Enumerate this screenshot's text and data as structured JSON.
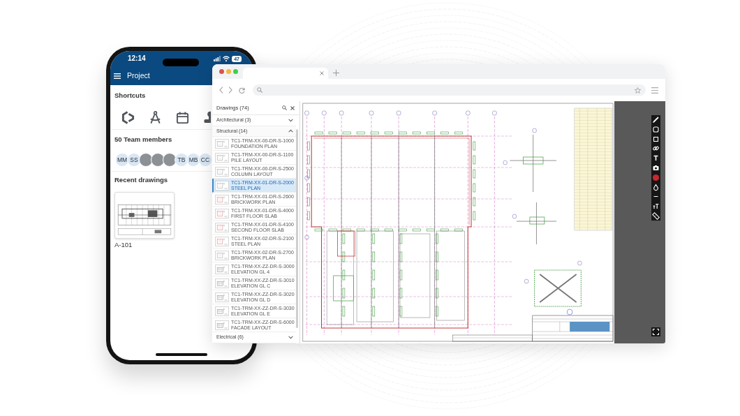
{
  "phone": {
    "status_bar": {
      "time": "12:14",
      "battery": "47"
    },
    "header": {
      "title": "Project"
    },
    "shortcuts": {
      "title": "Shortcuts"
    },
    "team": {
      "title": "50 Team members",
      "members": [
        {
          "kind": "initials",
          "label": "MM"
        },
        {
          "kind": "initials",
          "label": "SS"
        },
        {
          "kind": "photo"
        },
        {
          "kind": "photo"
        },
        {
          "kind": "photo"
        },
        {
          "kind": "initials",
          "label": "TB"
        },
        {
          "kind": "initials",
          "label": "MB"
        },
        {
          "kind": "initials",
          "label": "CC"
        }
      ]
    },
    "recent": {
      "title": "Recent drawings",
      "drawings": [
        {
          "label": "A-101"
        }
      ]
    }
  },
  "browser": {
    "drawings_panel": {
      "title": "Drawings (74)",
      "groups": [
        {
          "label": "Architectural (3)",
          "expanded": false
        },
        {
          "label": "Structural (14)",
          "expanded": true,
          "items": [
            {
              "code": "TC1-TRM-XX-00-DR-S-1000",
              "name": "FOUNDATION PLAN",
              "selected": false
            },
            {
              "code": "TC1-TRM-XX-00-DR-S-1100",
              "name": "PILE LAYOUT",
              "selected": false
            },
            {
              "code": "TC1-TRM-XX-00-DR-S-2500",
              "name": "COLUMN LAYOUT",
              "selected": false
            },
            {
              "code": "TC1-TRM-XX-01-DR-S-2000",
              "name": "STEEL PLAN",
              "selected": true
            },
            {
              "code": "TC1-TRM-XX-01-DR-S-2600",
              "name": "BRICKWORK PLAN",
              "selected": false
            },
            {
              "code": "TC1-TRM-XX-01-DR-S-4000",
              "name": "FIRST FLOOR SLAB",
              "selected": false
            },
            {
              "code": "TC1-TRM-XX-01-DR-S-4100",
              "name": "SECOND FLOOR SLAB",
              "selected": false
            },
            {
              "code": "TC1-TRM-XX-02-DR-S-2100",
              "name": "STEEL PLAN",
              "selected": false
            },
            {
              "code": "TC1-TRM-XX-02-DR-S-2700",
              "name": "BRICKWORK PLAN",
              "selected": false
            },
            {
              "code": "TC1-TRM-XX-ZZ-DR-S-3000",
              "name": "ELEVATION GL 4",
              "selected": false
            },
            {
              "code": "TC1-TRM-XX-ZZ-DR-S-3010",
              "name": "ELEVATION GL C",
              "selected": false
            },
            {
              "code": "TC1-TRM-XX-ZZ-DR-S-3020",
              "name": "ELEVATION GL D",
              "selected": false
            },
            {
              "code": "TC1-TRM-XX-ZZ-DR-S-3030",
              "name": "ELEVATION GL E",
              "selected": false
            },
            {
              "code": "TC1-TRM-XX-ZZ-DR-S-6000",
              "name": "FACADE LAYOUT",
              "selected": false
            }
          ]
        },
        {
          "label": "Electrical (6)",
          "expanded": false
        }
      ]
    }
  }
}
